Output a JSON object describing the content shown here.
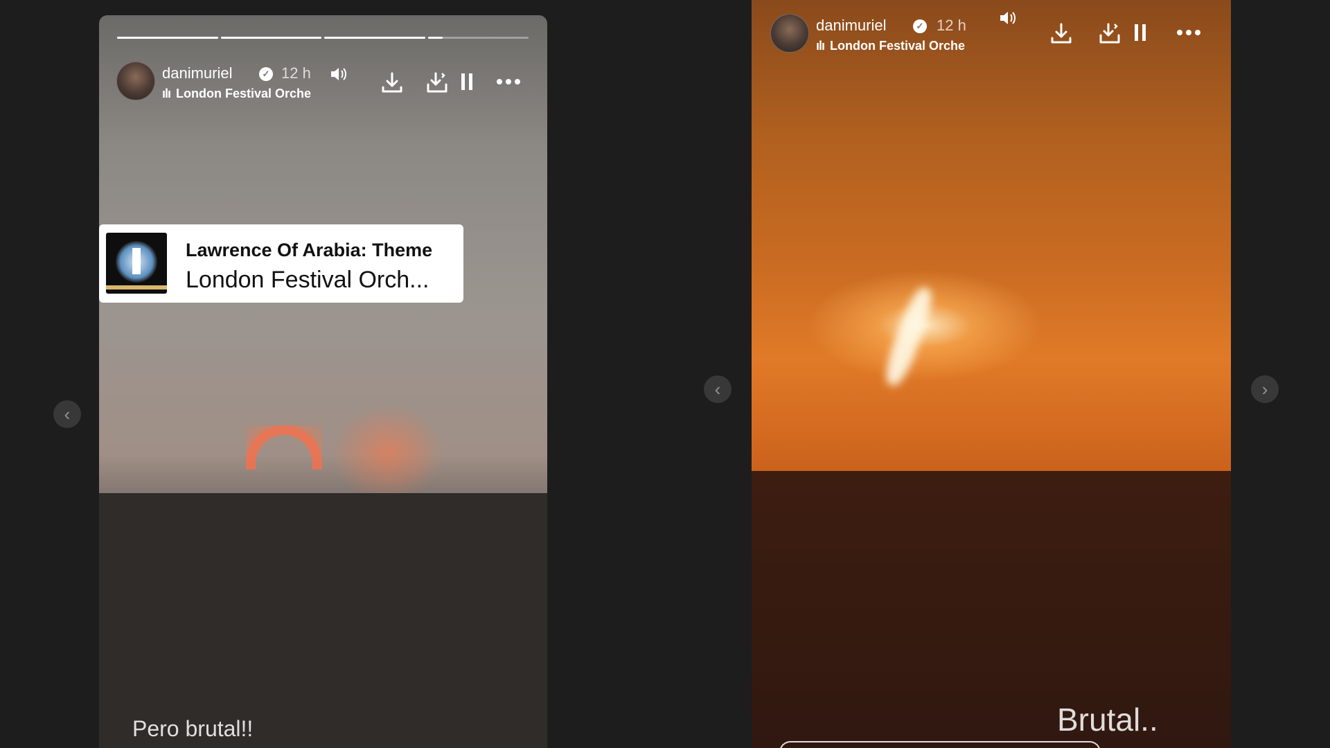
{
  "left_story": {
    "username": "danimuriel",
    "time": "12 h",
    "music_label": "London Festival Orche",
    "progress": [
      1,
      1,
      1,
      0.15
    ],
    "sticker": {
      "title": "Lawrence Of Arabia: Theme",
      "artist": "London Festival Orch..."
    },
    "caption": "Pero brutal!!"
  },
  "right_story": {
    "username": "danimuriel",
    "time": "12 h",
    "music_label": "London Festival Orche",
    "caption": "Brutal.."
  },
  "icons": {
    "verified": "verified-badge-icon",
    "sound": "speaker-icon",
    "download": "download-icon",
    "download_alt": "download-tray-icon",
    "pause": "pause-icon",
    "more": "more-dots-icon",
    "prev": "chevron-left-icon",
    "next": "chevron-right-icon"
  },
  "nav": {
    "prev_glyph": "‹",
    "next_glyph": "›"
  }
}
